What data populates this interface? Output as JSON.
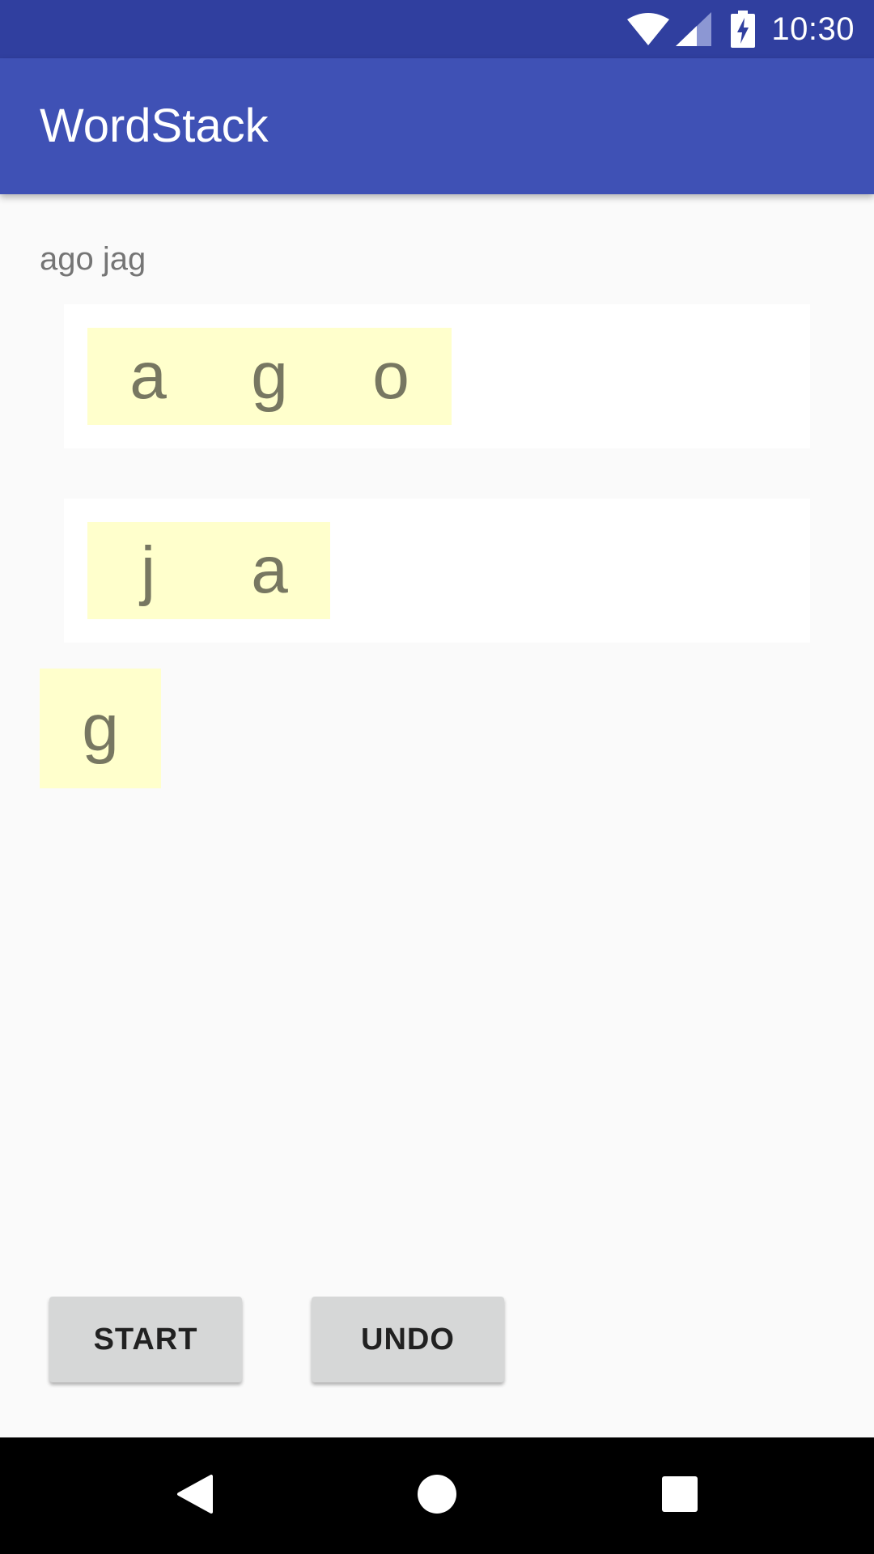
{
  "status_bar": {
    "time": "10:30",
    "icons": [
      "wifi-icon",
      "cell-signal-icon",
      "battery-charging-icon"
    ]
  },
  "app_bar": {
    "title": "WordStack"
  },
  "target_words": "ago jag",
  "stacks": [
    {
      "tiles": [
        "a",
        "g",
        "o"
      ]
    },
    {
      "tiles": [
        "j",
        "a"
      ]
    }
  ],
  "scrambled_tiles": [
    "g"
  ],
  "buttons": {
    "start_label": "START",
    "undo_label": "UNDO"
  },
  "nav_bar": {
    "icons": [
      "back-icon",
      "home-icon",
      "recents-icon"
    ]
  },
  "colors": {
    "status_bar": "#303f9f",
    "app_bar": "#3f51b5",
    "tile_background": "#ffffcc",
    "tile_text": "#777761",
    "button_background": "#d6d7d7"
  }
}
